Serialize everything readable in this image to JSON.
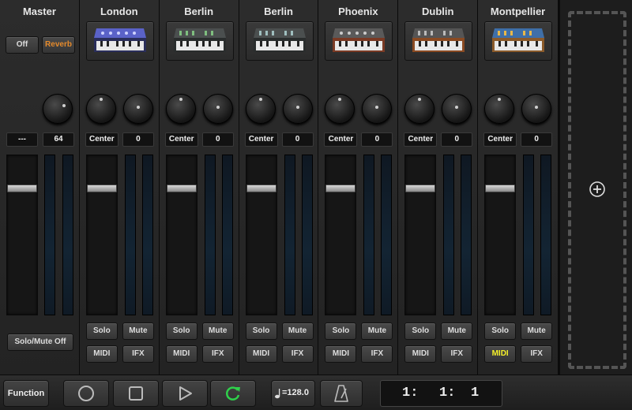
{
  "master": {
    "title": "Master",
    "off_label": "Off",
    "reverb_label": "Reverb",
    "left_value": "---",
    "right_value": "64",
    "solo_mute_off_label": "Solo/Mute Off"
  },
  "channels": [
    {
      "name": "London",
      "pan": "Center",
      "value": "0",
      "solo": "Solo",
      "mute": "Mute",
      "midi": "MIDI",
      "ifx": "IFX",
      "midi_active": false,
      "synth_color": "#5a62c8"
    },
    {
      "name": "Berlin",
      "pan": "Center",
      "value": "0",
      "solo": "Solo",
      "mute": "Mute",
      "midi": "MIDI",
      "ifx": "IFX",
      "midi_active": false,
      "synth_color": "#4b4f4f"
    },
    {
      "name": "Berlin",
      "pan": "Center",
      "value": "0",
      "solo": "Solo",
      "mute": "Mute",
      "midi": "MIDI",
      "ifx": "IFX",
      "midi_active": false,
      "synth_color": "#4b4f4f"
    },
    {
      "name": "Phoenix",
      "pan": "Center",
      "value": "0",
      "solo": "Solo",
      "mute": "Mute",
      "midi": "MIDI",
      "ifx": "IFX",
      "midi_active": false,
      "synth_color": "#5a5a5a"
    },
    {
      "name": "Dublin",
      "pan": "Center",
      "value": "0",
      "solo": "Solo",
      "mute": "Mute",
      "midi": "MIDI",
      "ifx": "IFX",
      "midi_active": false,
      "synth_color": "#5a4a40"
    },
    {
      "name": "Montpellier",
      "pan": "Center",
      "value": "0",
      "solo": "Solo",
      "mute": "Mute",
      "midi": "MIDI",
      "ifx": "IFX",
      "midi_active": true,
      "synth_color": "#3f6fa8"
    }
  ],
  "transport": {
    "function_label": "Function",
    "tempo": "=128.0",
    "position": [
      "1:",
      "1:",
      "1"
    ]
  },
  "colors": {
    "midi_active": "#f5f02a",
    "loop_green": "#2fd14b",
    "reverb_orange": "#e58a2b"
  },
  "icons": {
    "add": "plus-circle-icon",
    "record": "circle-icon",
    "stop": "square-icon",
    "play": "triangle-icon",
    "loop": "loop-arrows-icon",
    "metronome": "metronome-icon",
    "note": "music-note-icon"
  }
}
